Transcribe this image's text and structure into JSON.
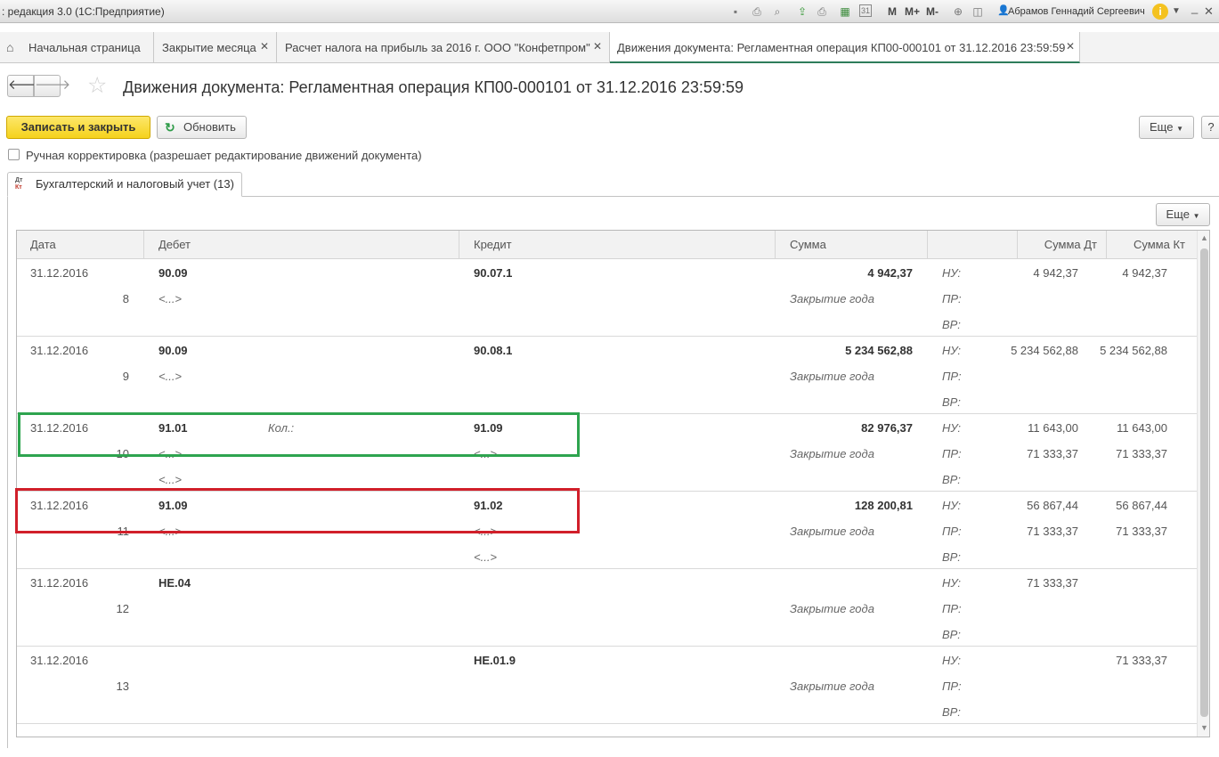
{
  "app_title": ": редакция 3.0  (1С:Предприятие)",
  "user": "Абрамов Геннадий Сергеевич",
  "toolbar": {
    "m": "M",
    "mplus": "M+",
    "mminus": "M-",
    "calendar_day": "31",
    "info": "i"
  },
  "tabs": [
    {
      "label": "Начальная страница"
    },
    {
      "label": "Закрытие месяца"
    },
    {
      "label": "Расчет налога на прибыль за 2016 г. ООО \"Конфетпром\""
    },
    {
      "label": "Движения документа: Регламентная операция КП00-000101 от 31.12.2016 23:59:59"
    }
  ],
  "page_title": "Движения документа: Регламентная операция КП00-000101 от 31.12.2016 23:59:59",
  "buttons": {
    "save_close": "Записать и закрыть",
    "refresh": "Обновить",
    "more": "Еще",
    "help": "?"
  },
  "manual_checkbox_label": "Ручная корректировка (разрешает редактирование движений документа)",
  "manual_checked": false,
  "sub_tab": {
    "icon_top": "Дт",
    "icon_bottom": "Кт",
    "label": "Бухгалтерский и налоговый учет (13)"
  },
  "grid_more": "Еще",
  "columns": [
    "Дата",
    "Дебет",
    "Кредит",
    "Сумма",
    "",
    "Сумма Дт",
    "Сумма Кт"
  ],
  "tax_labels": [
    "НУ:",
    "ПР:",
    "ВР:"
  ],
  "rows": [
    {
      "date": "31.12.2016",
      "n": "8",
      "debit": "90.09",
      "debit_qty": "",
      "debit_sub": "<...>",
      "credit": "90.07.1",
      "credit_sub": "",
      "credit_sub2": "",
      "sum": "4 942,37",
      "content": "Закрытие года",
      "sum_dt": [
        "4 942,37",
        "",
        ""
      ],
      "sum_kt": [
        "4 942,37",
        "",
        ""
      ]
    },
    {
      "date": "31.12.2016",
      "n": "9",
      "debit": "90.09",
      "debit_qty": "",
      "debit_sub": "<...>",
      "credit": "90.08.1",
      "credit_sub": "",
      "credit_sub2": "",
      "sum": "5 234 562,88",
      "content": "Закрытие года",
      "sum_dt": [
        "5 234 562,88",
        "",
        ""
      ],
      "sum_kt": [
        "5 234 562,88",
        "",
        ""
      ]
    },
    {
      "date": "31.12.2016",
      "n": "10",
      "debit": "91.01",
      "debit_qty": "Кол.:",
      "debit_sub": "<...>",
      "debit_sub2": "<...>",
      "credit": "91.09",
      "credit_sub": "<...>",
      "credit_sub2": "",
      "sum": "82 976,37",
      "content": "Закрытие года",
      "sum_dt": [
        "11 643,00",
        "71 333,37",
        ""
      ],
      "sum_kt": [
        "11 643,00",
        "71 333,37",
        ""
      ]
    },
    {
      "date": "31.12.2016",
      "n": "11",
      "debit": "91.09",
      "debit_qty": "",
      "debit_sub": "<...>",
      "credit": "91.02",
      "credit_sub": "<...>",
      "credit_sub2": "<...>",
      "sum": "128 200,81",
      "content": "Закрытие года",
      "sum_dt": [
        "56 867,44",
        "71 333,37",
        ""
      ],
      "sum_kt": [
        "56 867,44",
        "71 333,37",
        ""
      ]
    },
    {
      "date": "31.12.2016",
      "n": "12",
      "debit": "НЕ.04",
      "debit_qty": "",
      "debit_sub": "",
      "credit": "",
      "credit_sub": "",
      "credit_sub2": "",
      "sum": "",
      "content": "Закрытие года",
      "sum_dt": [
        "71 333,37",
        "",
        ""
      ],
      "sum_kt": [
        "",
        "",
        ""
      ]
    },
    {
      "date": "31.12.2016",
      "n": "13",
      "debit": "",
      "debit_qty": "",
      "debit_sub": "",
      "credit": "НЕ.01.9",
      "credit_sub": "",
      "credit_sub2": "",
      "sum": "",
      "content": "Закрытие года",
      "sum_dt": [
        "",
        "",
        ""
      ],
      "sum_kt": [
        "71 333,37",
        "",
        ""
      ]
    }
  ]
}
